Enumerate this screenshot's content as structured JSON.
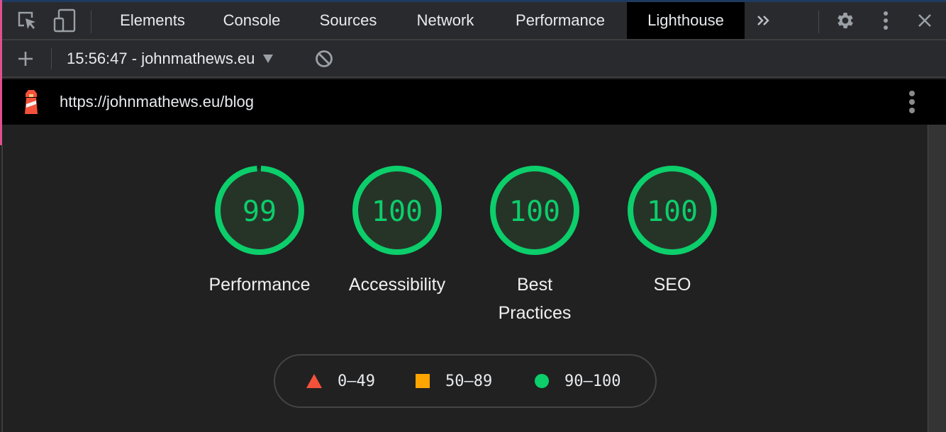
{
  "devtools": {
    "tabs": [
      {
        "label": "Elements",
        "active": false
      },
      {
        "label": "Console",
        "active": false
      },
      {
        "label": "Sources",
        "active": false
      },
      {
        "label": "Network",
        "active": false
      },
      {
        "label": "Performance",
        "active": false
      },
      {
        "label": "Lighthouse",
        "active": true
      }
    ],
    "icons": {
      "inspect": "element-picker-icon",
      "device": "device-toggle-icon",
      "more_tabs": "chevron-double-right-icon",
      "settings": "gear-icon",
      "menu": "kebab-menu-icon",
      "close": "close-icon"
    }
  },
  "toolbar": {
    "report_selector": "15:56:47 - johnmathews.eu",
    "icons": {
      "add": "plus-icon",
      "dropdown": "dropdown-triangle-icon",
      "clear": "block-icon"
    }
  },
  "report": {
    "url": "https://johnmathews.eu/blog",
    "icons": {
      "logo": "lighthouse-icon",
      "menu": "kebab-menu-icon"
    },
    "scores": [
      {
        "label": "Performance",
        "value": 99
      },
      {
        "label": "Accessibility",
        "value": 100
      },
      {
        "label": "Best Practices",
        "value": 100
      },
      {
        "label": "SEO",
        "value": 100
      }
    ],
    "legend": [
      {
        "shape": "triangle",
        "label": "0–49",
        "color": "#f4513b"
      },
      {
        "shape": "square",
        "label": "50–89",
        "color": "#ffa400"
      },
      {
        "shape": "circle",
        "label": "90–100",
        "color": "#0cce6b"
      }
    ],
    "colors": {
      "pass": "#0cce6b",
      "pass_fill": "#263428"
    }
  }
}
